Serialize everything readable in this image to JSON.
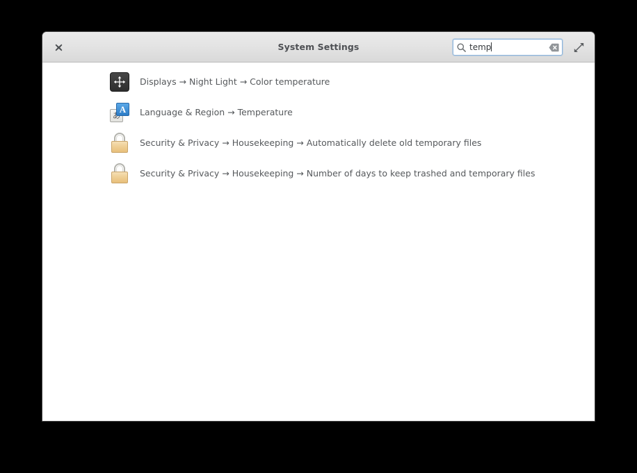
{
  "window": {
    "title": "System Settings",
    "close_label": "Close",
    "close_icon": "close-icon",
    "maximize_label": "Maximize",
    "maximize_icon": "maximize-icon"
  },
  "search": {
    "value": "temp",
    "placeholder": "Search",
    "search_icon": "search-icon",
    "clear_icon": "clear-entry-icon",
    "focus_color": "#8fb6dd"
  },
  "results": [
    {
      "icon": "displays-move-arrows-icon",
      "label": "Displays → Night Light → Color temperature",
      "panel": "Displays",
      "section": "Night Light",
      "setting": "Color temperature"
    },
    {
      "icon": "language-region-icon",
      "icon_front_letter": "A",
      "icon_back_letter": "あ",
      "label": "Language & Region → Temperature",
      "panel": "Language & Region",
      "section": "Temperature",
      "setting": ""
    },
    {
      "icon": "security-privacy-lock-icon",
      "label": "Security & Privacy → Housekeeping → Automatically delete old temporary files",
      "panel": "Security & Privacy",
      "section": "Housekeeping",
      "setting": "Automatically delete old temporary files"
    },
    {
      "icon": "security-privacy-lock-icon",
      "label": "Security & Privacy → Housekeeping → Number of days to keep trashed and temporary files",
      "panel": "Security & Privacy",
      "section": "Housekeeping",
      "setting": "Number of days to keep trashed and temporary files"
    }
  ],
  "colors": {
    "titlebar_top": "#ebebeb",
    "titlebar_bottom": "#d9d9d9",
    "titlebar_border": "#bcbcbc",
    "text": "#56595c",
    "title_text": "#4e5054",
    "content_background": "#ffffff",
    "desktop_background": "#000000"
  }
}
